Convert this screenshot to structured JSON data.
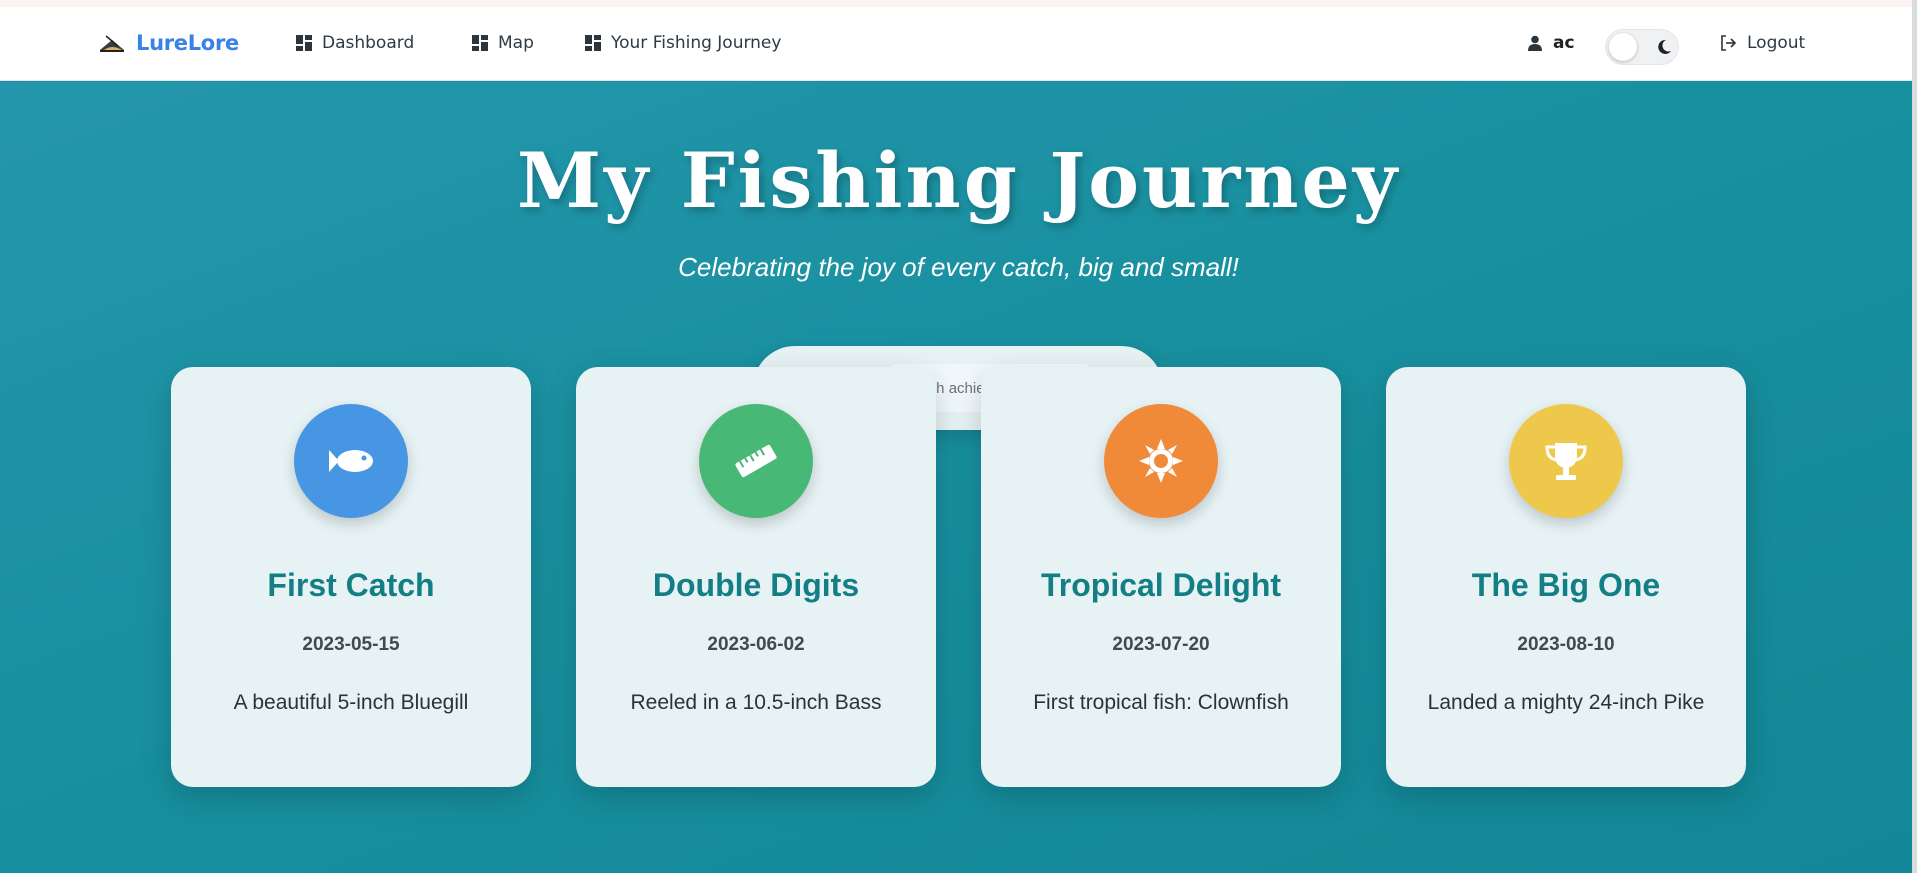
{
  "app": {
    "name": "LureLore"
  },
  "nav": {
    "links": [
      {
        "label": "Dashboard",
        "icon": "dashboard-icon"
      },
      {
        "label": "Map",
        "icon": "dashboard-icon"
      },
      {
        "label": "Your Fishing Journey",
        "icon": "dashboard-icon"
      }
    ],
    "user": {
      "name": "ac",
      "icon": "user-icon"
    },
    "theme_toggle": {
      "icon": "moon-icon",
      "state": "light"
    },
    "logout": {
      "label": "Logout",
      "icon": "logout-icon"
    }
  },
  "hero": {
    "title": "My Fishing Journey",
    "subtitle": "Celebrating the joy of every catch, big and small!"
  },
  "search": {
    "placeholder": "Search achievements...",
    "value": "",
    "icon": "search-icon"
  },
  "achievements": [
    {
      "title": "First Catch",
      "date": "2023-05-15",
      "description": "A beautiful 5-inch Bluegill",
      "icon": "fish-icon",
      "color": "#4796e4"
    },
    {
      "title": "Double Digits",
      "date": "2023-06-02",
      "description": "Reeled in a 10.5-inch Bass",
      "icon": "ruler-icon",
      "color": "#48b876"
    },
    {
      "title": "Tropical Delight",
      "date": "2023-07-20",
      "description": "First tropical fish: Clownfish",
      "icon": "sun-icon",
      "color": "#f08a38"
    },
    {
      "title": "The Big One",
      "date": "2023-08-10",
      "description": "Landed a mighty 24-inch Pike",
      "icon": "trophy-icon",
      "color": "#eec84a"
    }
  ],
  "colors": {
    "brand": "#3b82e6",
    "hero_background": "#1a8fa0",
    "card_background": "#e6f2f4",
    "card_title": "#137f85"
  }
}
